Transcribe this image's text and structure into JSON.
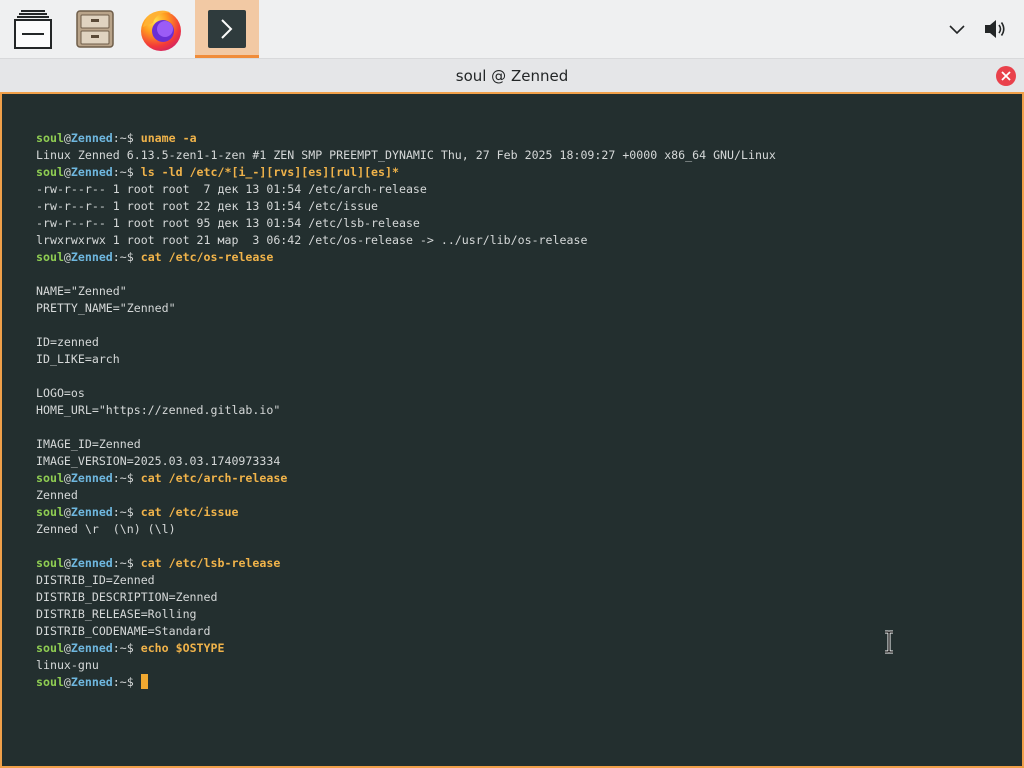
{
  "taskbar": {
    "launchers": [
      {
        "name": "show-desktop",
        "icon": "stack-windows-icon"
      },
      {
        "name": "file-manager",
        "icon": "file-cabinet-icon"
      },
      {
        "name": "firefox",
        "icon": "firefox-icon"
      },
      {
        "name": "terminal",
        "icon": "terminal-prompt-icon",
        "active": true
      }
    ],
    "tray": [
      {
        "name": "expand-tray",
        "icon": "chevron-down-icon"
      },
      {
        "name": "volume",
        "icon": "speaker-icon"
      }
    ]
  },
  "window": {
    "title": "soul @ Zenned",
    "close_icon": "close-icon"
  },
  "prompt": {
    "user": "soul",
    "at": "@",
    "host": "Zenned",
    "suffix": ":~$ "
  },
  "terminal": {
    "lines": [
      {
        "type": "prompt",
        "cmd": "uname -a"
      },
      {
        "type": "out",
        "text": "Linux Zenned 6.13.5-zen1-1-zen #1 ZEN SMP PREEMPT_DYNAMIC Thu, 27 Feb 2025 18:09:27 +0000 x86_64 GNU/Linux"
      },
      {
        "type": "prompt",
        "cmd": "ls -ld /etc/*[i_-][rvs][es][rul][es]*"
      },
      {
        "type": "out",
        "text": "-rw-r--r-- 1 root root  7 дек 13 01:54 /etc/arch-release"
      },
      {
        "type": "out",
        "text": "-rw-r--r-- 1 root root 22 дек 13 01:54 /etc/issue"
      },
      {
        "type": "out",
        "text": "-rw-r--r-- 1 root root 95 дек 13 01:54 /etc/lsb-release"
      },
      {
        "type": "out",
        "text": "lrwxrwxrwx 1 root root 21 мар  3 06:42 /etc/os-release -> ../usr/lib/os-release"
      },
      {
        "type": "prompt",
        "cmd": "cat /etc/os-release"
      },
      {
        "type": "out",
        "text": ""
      },
      {
        "type": "out",
        "text": "NAME=\"Zenned\""
      },
      {
        "type": "out",
        "text": "PRETTY_NAME=\"Zenned\""
      },
      {
        "type": "out",
        "text": ""
      },
      {
        "type": "out",
        "text": "ID=zenned"
      },
      {
        "type": "out",
        "text": "ID_LIKE=arch"
      },
      {
        "type": "out",
        "text": ""
      },
      {
        "type": "out",
        "text": "LOGO=os"
      },
      {
        "type": "out",
        "text": "HOME_URL=\"https://zenned.gitlab.io\""
      },
      {
        "type": "out",
        "text": ""
      },
      {
        "type": "out",
        "text": "IMAGE_ID=Zenned"
      },
      {
        "type": "out",
        "text": "IMAGE_VERSION=2025.03.03.1740973334"
      },
      {
        "type": "prompt",
        "cmd": "cat /etc/arch-release"
      },
      {
        "type": "out",
        "text": "Zenned"
      },
      {
        "type": "prompt",
        "cmd": "cat /etc/issue"
      },
      {
        "type": "out",
        "text": "Zenned \\r  (\\n) (\\l)"
      },
      {
        "type": "out",
        "text": ""
      },
      {
        "type": "prompt",
        "cmd": "cat /etc/lsb-release"
      },
      {
        "type": "out",
        "text": "DISTRIB_ID=Zenned"
      },
      {
        "type": "out",
        "text": "DISTRIB_DESCRIPTION=Zenned"
      },
      {
        "type": "out",
        "text": "DISTRIB_RELEASE=Rolling"
      },
      {
        "type": "out",
        "text": "DISTRIB_CODENAME=Standard"
      },
      {
        "type": "prompt",
        "cmd": "echo $OSTYPE"
      },
      {
        "type": "out",
        "text": "linux-gnu"
      },
      {
        "type": "prompt",
        "cmd": "",
        "cursor": true
      }
    ]
  },
  "colors": {
    "terminal_bg": "#232f2f",
    "user": "#8fcd52",
    "host": "#6fb8e0",
    "command": "#f0b34a",
    "accent": "#f0a04a"
  }
}
